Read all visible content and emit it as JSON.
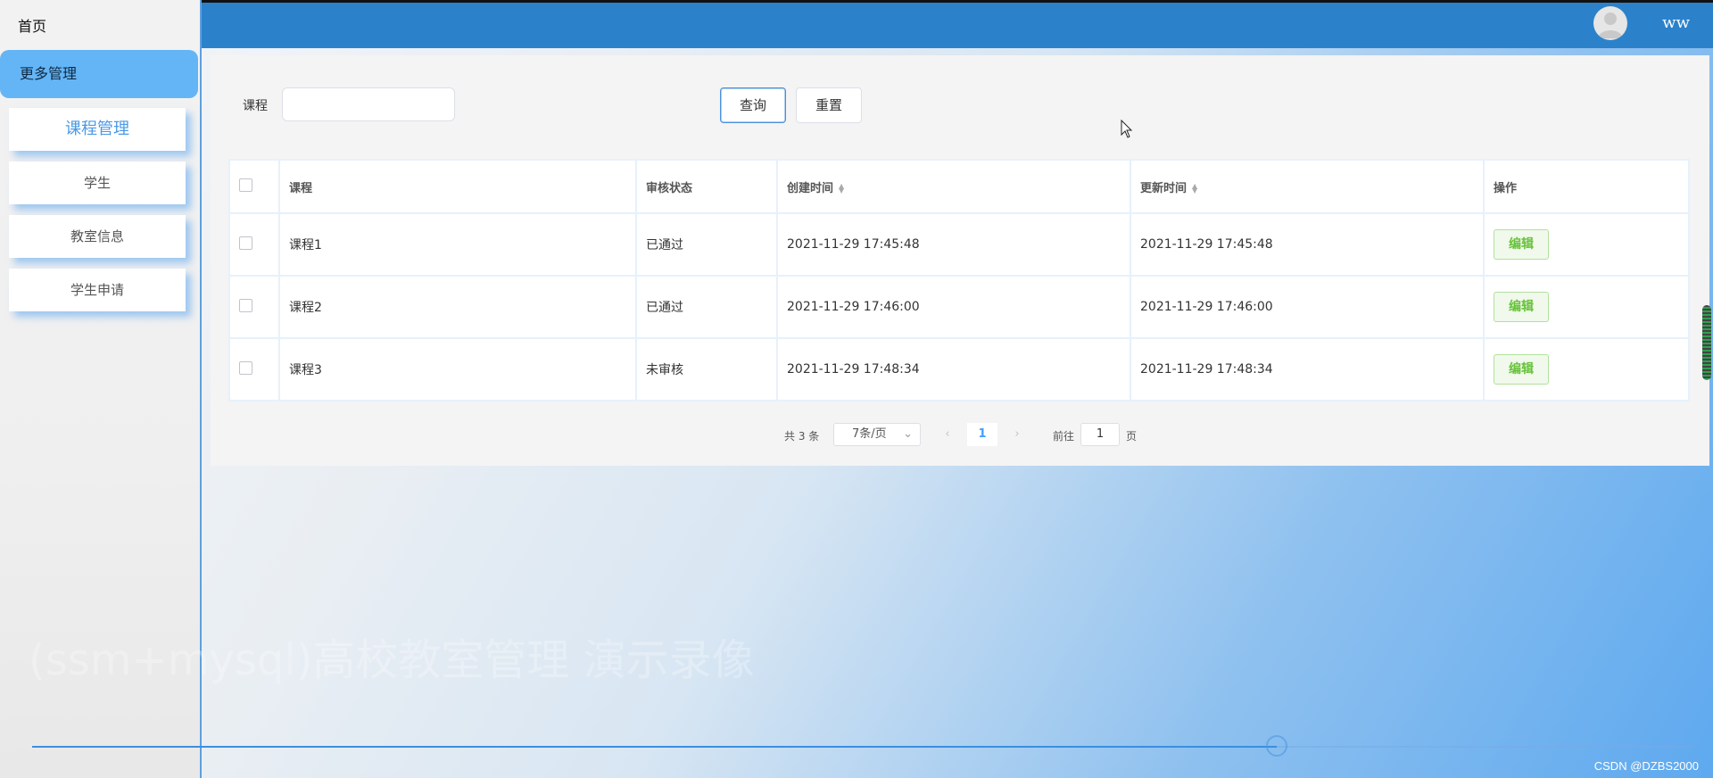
{
  "header": {
    "username": "ww",
    "avatar_icon": "user-avatar-icon"
  },
  "sidebar": {
    "home": "首页",
    "section": "更多管理",
    "items": [
      {
        "label": "课程管理",
        "active": true
      },
      {
        "label": "学生"
      },
      {
        "label": "教室信息"
      },
      {
        "label": "学生申请"
      }
    ]
  },
  "search": {
    "label": "课程",
    "value": "",
    "query_button": "查询",
    "reset_button": "重置"
  },
  "table": {
    "headers": [
      "课程",
      "审核状态",
      "创建时间",
      "更新时间",
      "操作"
    ],
    "rows": [
      {
        "course": "课程1",
        "status": "已通过",
        "created": "2021-11-29 17:45:48",
        "updated": "2021-11-29 17:45:48",
        "action": "编辑"
      },
      {
        "course": "课程2",
        "status": "已通过",
        "created": "2021-11-29 17:46:00",
        "updated": "2021-11-29 17:46:00",
        "action": "编辑"
      },
      {
        "course": "课程3",
        "status": "未审核",
        "created": "2021-11-29 17:48:34",
        "updated": "2021-11-29 17:48:34",
        "action": "编辑"
      }
    ]
  },
  "pagination": {
    "total": "共 3 条",
    "page_size": "7条/页",
    "current_page": "1",
    "goto_label": "前往",
    "goto_value": "1",
    "page_suffix": "页"
  },
  "video": {
    "watermark": "(ssm+mysql)高校教室管理 演示录像",
    "credit": "CSDN @DZBS2000",
    "progress": 0.75
  },
  "colors": {
    "accent": "#2b82cb",
    "sidebar_active": "#64b5f6",
    "edit_green": "#67c23a"
  }
}
